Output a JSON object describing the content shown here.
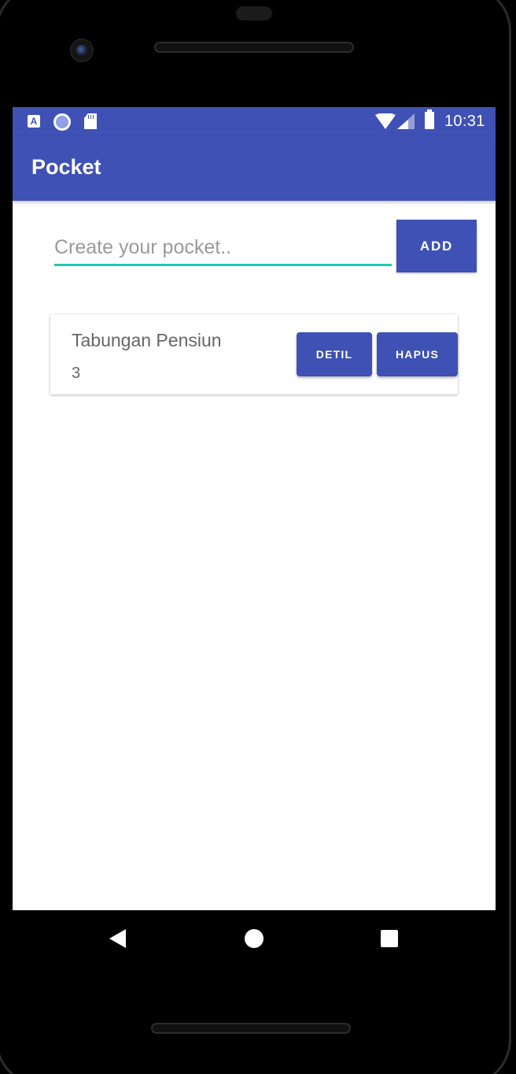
{
  "status_bar": {
    "time": "10:31",
    "icons": [
      "keyboard-a-icon",
      "record-circle-icon",
      "sd-card-icon",
      "wifi-icon",
      "cell-signal-icon",
      "battery-icon"
    ],
    "color": "#3f51b5"
  },
  "app_bar": {
    "title": "Pocket",
    "color": "#3f51b5"
  },
  "create_form": {
    "placeholder": "Create your pocket..",
    "value": "",
    "add_label": "ADD",
    "underline_color": "#1fc9b0"
  },
  "pockets": [
    {
      "name": "Tabungan Pensiun",
      "count": "3",
      "detail_label": "DETIL",
      "delete_label": "HAPUS"
    }
  ],
  "nav_bar": {
    "icons": [
      "back-icon",
      "home-icon",
      "recent-apps-icon"
    ]
  }
}
